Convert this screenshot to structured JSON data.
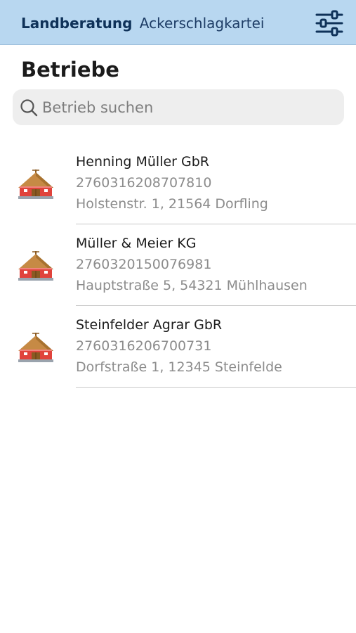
{
  "header": {
    "brand": "Landberatung",
    "subtitle": "Ackerschlagkartei",
    "menu_icon": "sliders-icon"
  },
  "page_title": "Betriebe",
  "search": {
    "placeholder": "Betrieb suchen",
    "value": "",
    "icon": "search-icon"
  },
  "farms": [
    {
      "name": "Henning Müller GbR",
      "id": "2760316208707810",
      "address": "Holstenstr. 1, 21564 Dorfling",
      "icon": "farmhouse-icon"
    },
    {
      "name": "Müller & Meier KG",
      "id": "2760320150076981",
      "address": "Hauptstraße 5, 54321 Mühlhausen",
      "icon": "farmhouse-icon"
    },
    {
      "name": "Steinfelder Agrar GbR",
      "id": "2760316206700731",
      "address": "Dorfstraße 1, 12345 Steinfelde",
      "icon": "farmhouse-icon"
    }
  ],
  "colors": {
    "header_bg": "#b8d7f0",
    "brand_text": "#0f3259",
    "search_bg": "#eeeeee",
    "roof": "#b8813f",
    "walls": "#e0433c"
  }
}
